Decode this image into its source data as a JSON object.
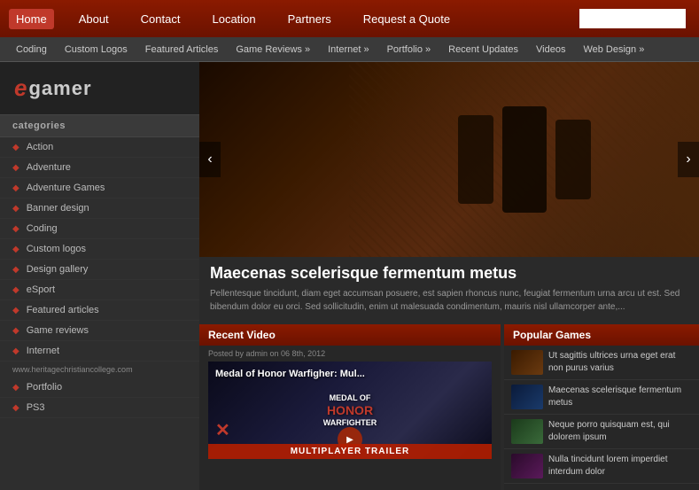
{
  "topNav": {
    "items": [
      {
        "label": "Home",
        "active": true
      },
      {
        "label": "About",
        "active": false
      },
      {
        "label": "Contact",
        "active": false
      },
      {
        "label": "Location",
        "active": false
      },
      {
        "label": "Partners",
        "active": false
      },
      {
        "label": "Request a Quote",
        "active": false
      }
    ],
    "search_placeholder": ""
  },
  "secNav": {
    "items": [
      {
        "label": "Coding"
      },
      {
        "label": "Custom Logos"
      },
      {
        "label": "Featured Articles"
      },
      {
        "label": "Game Reviews »"
      },
      {
        "label": "Internet »"
      },
      {
        "label": "Portfolio »"
      },
      {
        "label": "Recent Updates"
      },
      {
        "label": "Videos"
      },
      {
        "label": "Web Design »"
      }
    ]
  },
  "sidebar": {
    "logo_e": "e",
    "logo_text": "gamer",
    "categories_label": "categories",
    "items": [
      {
        "label": "Action"
      },
      {
        "label": "Adventure"
      },
      {
        "label": "Adventure Games"
      },
      {
        "label": "Banner design"
      },
      {
        "label": "Coding"
      },
      {
        "label": "Custom logos"
      },
      {
        "label": "Design gallery"
      },
      {
        "label": "eSport"
      },
      {
        "label": "Featured articles"
      },
      {
        "label": "Game reviews"
      },
      {
        "label": "Internet"
      },
      {
        "label": "Portfolio"
      },
      {
        "label": "PS3"
      }
    ],
    "url": "www.heritagechristiancollege.com"
  },
  "hero": {
    "nav_left": "‹",
    "nav_right": "›",
    "title": "Maecenas scelerisque fermentum metus",
    "description": "Pellentesque tincidunt, diam eget accumsan posuere, est sapien rhoncus nunc, feugiat fermentum urna arcu ut est. Sed bibendum dolor eu orci. Sed sollicitudin, enim ut malesuada condimentum, mauris nisl ullamcorper ante,..."
  },
  "recentVideo": {
    "section_title": "Recent Video",
    "meta": "Posted by admin on 06 8th, 2012",
    "video_title": "Medal of Honor Warfigher: Mul...",
    "video_logo_line1": "MEDAL OF",
    "video_logo_line2": "HONOR",
    "video_logo_line3": "WARFIGHTER",
    "multiplayer_text": "MULTIPLAYER TRAILER",
    "play_icon": "▶"
  },
  "popularGames": {
    "section_title": "Popular Games",
    "items": [
      {
        "title": "Ut sagittis ultrices urna eget erat non purus varius"
      },
      {
        "title": "Maecenas scelerisque fermentum metus"
      },
      {
        "title": "Neque porro quisquam est, qui dolorem ipsum"
      },
      {
        "title": "Nulla tincidunt lorem imperdiet interdum dolor"
      }
    ]
  }
}
